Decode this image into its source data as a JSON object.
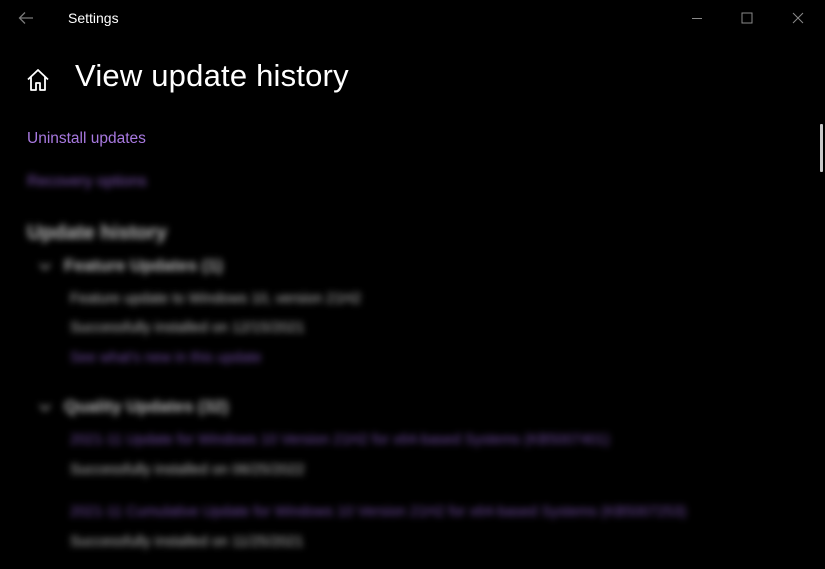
{
  "window": {
    "title": "Settings"
  },
  "header": {
    "title": "View update history"
  },
  "links": {
    "uninstall": "Uninstall updates",
    "recovery": "Recovery options"
  },
  "history": {
    "heading": "Update history",
    "feature_group": {
      "label": "Feature Updates (1)",
      "items": [
        {
          "title": "Feature update to Windows 10, version 21H2",
          "status": "Successfully installed on 12/15/2021",
          "link": "See what's new in this update"
        }
      ]
    },
    "quality_group": {
      "label": "Quality Updates (32)",
      "items": [
        {
          "title": "2021-11 Update for Windows 10 Version 21H2 for x64-based Systems (KB5007401)",
          "status": "Successfully installed on 06/25/2022"
        },
        {
          "title": "2021-11 Cumulative Update for Windows 10 Version 21H2 for x64-based Systems (KB5007253)",
          "status": "Successfully installed on 11/25/2021"
        }
      ]
    }
  },
  "icons": {
    "back": "back-arrow-icon",
    "home": "home-icon",
    "minimize": "minimize-icon",
    "maximize": "maximize-icon",
    "close": "close-icon",
    "chevron": "chevron-down-icon"
  },
  "colors": {
    "background": "#000000",
    "accent_link": "#a879e0",
    "text": "#ffffff"
  }
}
